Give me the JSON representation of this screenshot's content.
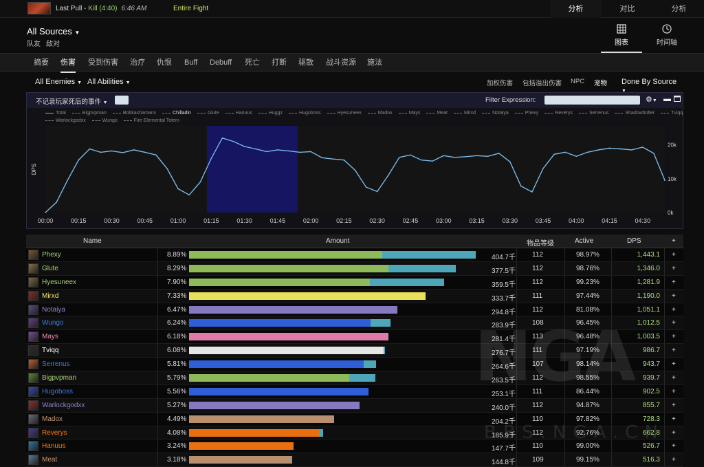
{
  "topbar": {
    "last_pull_label": "Last Pull",
    "separator": " - ",
    "kill_label": "Kill (4:40)",
    "time": "6:46 AM",
    "fight_label": "Entire Fight",
    "tabs": [
      "分析",
      "对比",
      "分析"
    ]
  },
  "source": {
    "title": "All Sources",
    "sub_friendly": "队友",
    "sub_enemy": "敌对",
    "view_chart": "图表",
    "view_timeline": "时间轴"
  },
  "data_tabs": [
    "摘要",
    "伤害",
    "受到伤害",
    "治疗",
    "仇恨",
    "Buff",
    "Debuff",
    "死亡",
    "打断",
    "驱散",
    "战斗资源",
    "施法"
  ],
  "filters": {
    "enemies": "All Enemies",
    "abilities": "All Abilities",
    "right": [
      "加权伤害",
      "包括溢出伤害",
      "NPC",
      "宠物"
    ],
    "group_by": "Done By Source"
  },
  "chart_panel": {
    "event_filter": "不记录玩家死后的事件",
    "filter_expression_label": "Filter Expression:",
    "filter_expression_value": "",
    "legend": [
      "Total",
      "Bigpvpman",
      "Bobkashamanx",
      "Chilladin",
      "Glute",
      "Hanuus",
      "Huggz",
      "Hugoboss",
      "Hyesuneex",
      "Madox",
      "Mays",
      "Meat",
      "Mirxd",
      "Notaiya",
      "Phexy",
      "Reverys",
      "Serrenus",
      "Shadowbolter",
      "Tviqq",
      "Warlockgodxx",
      "Wungo",
      "Fire Elemental Totem"
    ],
    "legend_highlight": "Chilladin"
  },
  "chart_data": {
    "type": "line",
    "title": "",
    "xlabel": "",
    "ylabel": "DPS",
    "x_ticks": [
      "00:00",
      "00:15",
      "00:30",
      "00:45",
      "01:00",
      "01:15",
      "01:30",
      "01:45",
      "02:00",
      "02:15",
      "02:30",
      "02:45",
      "03:00",
      "03:15",
      "03:30",
      "03:45",
      "04:00",
      "04:15",
      "04:30"
    ],
    "y_ticks": [
      "0k",
      "10k",
      "20k"
    ],
    "ylim": [
      0,
      20000
    ],
    "xlim_sec": [
      0,
      280
    ],
    "selection_sec": [
      73,
      114
    ],
    "series": [
      {
        "name": "Total",
        "color": "#7ab8e6",
        "x_sec": [
          0,
          5,
          10,
          15,
          20,
          25,
          30,
          35,
          40,
          45,
          50,
          55,
          60,
          65,
          70,
          75,
          80,
          85,
          90,
          95,
          100,
          105,
          110,
          115,
          120,
          125,
          130,
          135,
          140,
          145,
          150,
          155,
          160,
          165,
          170,
          175,
          180,
          185,
          190,
          195,
          200,
          205,
          210,
          215,
          220,
          225,
          230,
          235,
          240,
          245,
          250,
          255,
          260,
          265,
          270,
          275,
          280
        ],
        "values": [
          0,
          3000,
          9500,
          15500,
          18800,
          17800,
          18200,
          17700,
          18500,
          17800,
          17000,
          13000,
          7000,
          5200,
          9000,
          16000,
          22000,
          21000,
          19500,
          18800,
          18000,
          18500,
          18200,
          17800,
          18000,
          16200,
          15800,
          15500,
          12500,
          7500,
          6200,
          11000,
          16300,
          17000,
          15500,
          15200,
          16800,
          16300,
          16500,
          16800,
          16600,
          17500,
          15000,
          7800,
          6100,
          13000,
          17200,
          17800,
          16600,
          17800,
          18500,
          19000,
          18800,
          18500,
          19300,
          17500,
          9500
        ]
      }
    ]
  },
  "table": {
    "headers": [
      "Name",
      "Amount",
      "物品等级",
      "Active",
      "DPS",
      "+"
    ],
    "rows": [
      {
        "name": "Phexy",
        "color": "#a9d271",
        "pct": "8.89%",
        "bar1": 0.651,
        "bar2": 0.314,
        "bar1c": "#8fba5a",
        "bar2c": "#4ea7b8",
        "amount": "404.7千",
        "ilvl": "112",
        "active": "98.97%",
        "dps": "1,443.1",
        "icon": "#7a5a30"
      },
      {
        "name": "Glute",
        "color": "#a9d271",
        "pct": "8.29%",
        "bar1": 0.672,
        "bar2": 0.228,
        "bar1c": "#8fba5a",
        "bar2c": "#4ea7b8",
        "amount": "377.5千",
        "ilvl": "112",
        "active": "98.76%",
        "dps": "1,346.0",
        "icon": "#8a7040"
      },
      {
        "name": "Hyesuneex",
        "color": "#a9d271",
        "pct": "7.90%",
        "bar1": 0.608,
        "bar2": 0.249,
        "bar1c": "#8fba5a",
        "bar2c": "#4ea7b8",
        "amount": "359.5千",
        "ilvl": "112",
        "active": "99.23%",
        "dps": "1,281.9",
        "icon": "#7a6a3a"
      },
      {
        "name": "Mirxd",
        "color": "#f0ea6a",
        "pct": "7.33%",
        "bar1": 0.796,
        "bar2": 0,
        "bar1c": "#e8e05a",
        "bar2c": "#4ea7b8",
        "amount": "333.7千",
        "ilvl": "111",
        "active": "97.44%",
        "dps": "1,190.0",
        "icon": "#8a2a2a"
      },
      {
        "name": "Notaiya",
        "color": "#9482c9",
        "pct": "6.47%",
        "bar1": 0.701,
        "bar2": 0,
        "bar1c": "#8878c0",
        "bar2c": "#4ea7b8",
        "amount": "294.8千",
        "ilvl": "112",
        "active": "81.08%",
        "dps": "1,051.1",
        "icon": "#5a4a8a"
      },
      {
        "name": "Wungo",
        "color": "#3a7ae0",
        "pct": "6.24%",
        "bar1": 0.611,
        "bar2": 0.067,
        "bar1c": "#2f5fd8",
        "bar2c": "#4ea7b8",
        "amount": "283.9千",
        "ilvl": "108",
        "active": "96.45%",
        "dps": "1,012.5",
        "icon": "#6a3a8a"
      },
      {
        "name": "Mays",
        "color": "#f48cba",
        "pct": "6.18%",
        "bar1": 0.672,
        "bar2": 0,
        "bar1c": "#e07aa8",
        "bar2c": "#4ea7b8",
        "amount": "281.4千",
        "ilvl": "113",
        "active": "96.48%",
        "dps": "1,003.5",
        "icon": "#7a4a9a"
      },
      {
        "name": "Tviqq",
        "color": "#ffffff",
        "pct": "6.08%",
        "bar1": 0.655,
        "bar2": 0.005,
        "bar1c": "#e6e6e6",
        "bar2c": "#4ea7b8",
        "amount": "276.7千",
        "ilvl": "111",
        "active": "97.19%",
        "dps": "986.7",
        "icon": "#2a2a2a"
      },
      {
        "name": "Serrenus",
        "color": "#3a7ae0",
        "pct": "5.81%",
        "bar1": 0.589,
        "bar2": 0.042,
        "bar1c": "#2f5fd8",
        "bar2c": "#4ea7b8",
        "amount": "264.6千",
        "ilvl": "107",
        "active": "98.14%",
        "dps": "943.7",
        "icon": "#c0602a"
      },
      {
        "name": "Bigpvpman",
        "color": "#a9d271",
        "pct": "5.79%",
        "bar1": 0.539,
        "bar2": 0.089,
        "bar1c": "#8fba5a",
        "bar2c": "#4ea7b8",
        "amount": "263.5千",
        "ilvl": "112",
        "active": "98.55%",
        "dps": "939.7",
        "icon": "#5a8a2a"
      },
      {
        "name": "Hugoboss",
        "color": "#3a7ae0",
        "pct": "5.56%",
        "bar1": 0.605,
        "bar2": 0,
        "bar1c": "#2f5fd8",
        "bar2c": "#4ea7b8",
        "amount": "253.1千",
        "ilvl": "111",
        "active": "86.44%",
        "dps": "902.5",
        "icon": "#2a4ac0"
      },
      {
        "name": "Warlockgodxx",
        "color": "#9482c9",
        "pct": "5.27%",
        "bar1": 0.573,
        "bar2": 0,
        "bar1c": "#8878c0",
        "bar2c": "#4ea7b8",
        "amount": "240.0千",
        "ilvl": "112",
        "active": "94.87%",
        "dps": "855.7",
        "icon": "#a02a2a"
      },
      {
        "name": "Madox",
        "color": "#c69b6d",
        "pct": "4.49%",
        "bar1": 0.489,
        "bar2": 0,
        "bar1c": "#b89070",
        "bar2c": "#4ea7b8",
        "amount": "204.2千",
        "ilvl": "110",
        "active": "97.82%",
        "dps": "728.3",
        "icon": "#6a6a7a"
      },
      {
        "name": "Reverys",
        "color": "#ff7d0a",
        "pct": "4.08%",
        "bar1": 0.438,
        "bar2": 0.013,
        "bar1c": "#e87010",
        "bar2c": "#4ea7b8",
        "amount": "185.9千",
        "ilvl": "112",
        "active": "92.76%",
        "dps": "662.8",
        "icon": "#4a3a9a"
      },
      {
        "name": "Hanuus",
        "color": "#ff7d0a",
        "pct": "3.24%",
        "bar1": 0.353,
        "bar2": 0,
        "bar1c": "#e87010",
        "bar2c": "#4ea7b8",
        "amount": "147.7千",
        "ilvl": "110",
        "active": "99.00%",
        "dps": "526.7",
        "icon": "#2a7aaa"
      },
      {
        "name": "Meat",
        "color": "#c69b6d",
        "pct": "3.18%",
        "bar1": 0.347,
        "bar2": 0,
        "bar1c": "#b89070",
        "bar2c": "#4ea7b8",
        "amount": "144.8千",
        "ilvl": "109",
        "active": "99.15%",
        "dps": "516.3",
        "icon": "#5a7a9a"
      }
    ]
  },
  "watermark": {
    "big": "NGA",
    "small": "BBS.NGA.CN"
  }
}
